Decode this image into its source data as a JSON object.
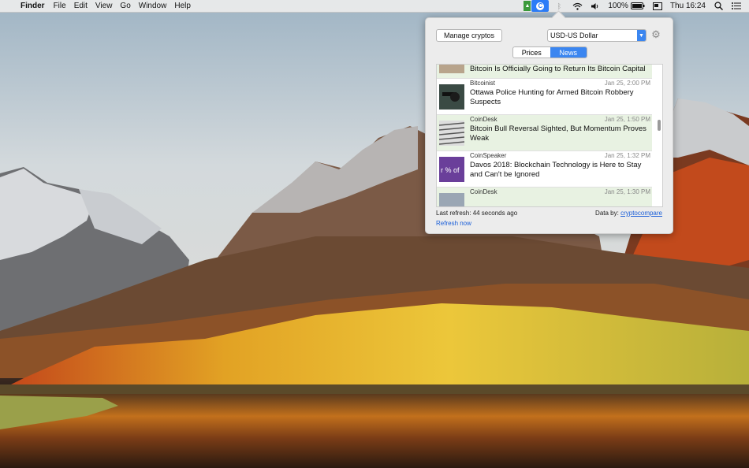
{
  "menubar": {
    "app_name": "Finder",
    "menus": [
      "File",
      "Edit",
      "View",
      "Go",
      "Window",
      "Help"
    ],
    "battery": "100%",
    "clock": "Thu 16:24"
  },
  "popover": {
    "manage_button": "Manage cryptos",
    "currency": "USD-US Dollar",
    "tabs": [
      "Prices",
      "News"
    ],
    "active_tab": "News",
    "news": [
      {
        "source": "",
        "date": "",
        "title": "Bitcoin Is Officially Going to Return Its Bitcoin Capital",
        "highlight": true
      },
      {
        "source": "Bitcoinist",
        "date": "Jan 25, 2:00 PM",
        "title": "Ottawa Police Hunting for Armed Bitcoin Robbery Suspects",
        "highlight": false
      },
      {
        "source": "CoinDesk",
        "date": "Jan 25, 1:50 PM",
        "title": "Bitcoin Bull Reversal Sighted, But Momentum Proves Weak",
        "highlight": true
      },
      {
        "source": "CoinSpeaker",
        "date": "Jan 25, 1:32 PM",
        "title": "Davos 2018: Blockchain Technology is Here to Stay and Can't be Ignored",
        "highlight": false
      },
      {
        "source": "CoinDesk",
        "date": "Jan 25, 1:30 PM",
        "title": "",
        "highlight": true
      }
    ],
    "last_refresh": "Last refresh: 44 seconds ago",
    "data_by_label": "Data by:",
    "data_by_link": "cryptocompare",
    "refresh_now": "Refresh now"
  }
}
